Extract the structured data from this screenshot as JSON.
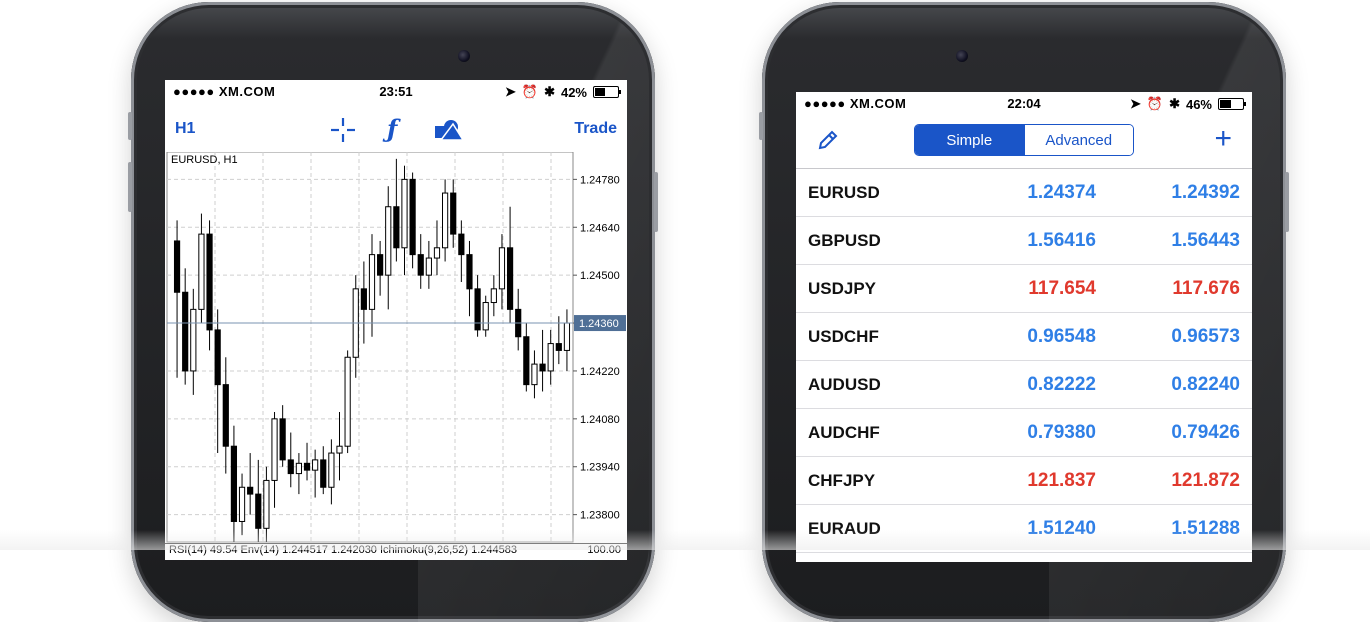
{
  "left_phone": {
    "status": {
      "carrier": "●●●●● XM.COM",
      "time": "23:51",
      "battery_pct": "42%",
      "battery_level": 0.42
    },
    "toolbar": {
      "timeframe": "H1",
      "trade_label": "Trade",
      "icons": [
        "crosshair-icon",
        "function-icon",
        "shapes-icon"
      ]
    },
    "chart": {
      "title": "EURUSD, H1",
      "price_labels": [
        "1.24780",
        "1.24640",
        "1.24500",
        "1.24360",
        "1.24220",
        "1.24080",
        "1.23940",
        "1.23800"
      ],
      "current_price": "1.24360",
      "indicators": "RSI(14) 49.54 Env(14) 1.244517 1.242030 Ichimoku(9,26,52) 1.244583",
      "indicator_right": "100.00"
    }
  },
  "chart_data": {
    "type": "candlestick",
    "title": "EURUSD, H1",
    "ylim": [
      1.2372,
      1.2486
    ],
    "y_ticks": [
      1.2478,
      1.2464,
      1.245,
      1.2436,
      1.2422,
      1.2408,
      1.2394,
      1.238
    ],
    "current": 1.2436,
    "candles": [
      {
        "o": 1.246,
        "h": 1.2466,
        "l": 1.242,
        "c": 1.2445
      },
      {
        "o": 1.2445,
        "h": 1.2452,
        "l": 1.2418,
        "c": 1.2422
      },
      {
        "o": 1.2422,
        "h": 1.2446,
        "l": 1.2415,
        "c": 1.244
      },
      {
        "o": 1.244,
        "h": 1.2468,
        "l": 1.2436,
        "c": 1.2462
      },
      {
        "o": 1.2462,
        "h": 1.2466,
        "l": 1.2428,
        "c": 1.2434
      },
      {
        "o": 1.2434,
        "h": 1.244,
        "l": 1.2398,
        "c": 1.2418
      },
      {
        "o": 1.2418,
        "h": 1.2426,
        "l": 1.2392,
        "c": 1.24
      },
      {
        "o": 1.24,
        "h": 1.2406,
        "l": 1.2372,
        "c": 1.2378
      },
      {
        "o": 1.2378,
        "h": 1.2392,
        "l": 1.2374,
        "c": 1.2388
      },
      {
        "o": 1.2388,
        "h": 1.2398,
        "l": 1.238,
        "c": 1.2386
      },
      {
        "o": 1.2386,
        "h": 1.2396,
        "l": 1.2372,
        "c": 1.2376
      },
      {
        "o": 1.2376,
        "h": 1.2394,
        "l": 1.2372,
        "c": 1.239
      },
      {
        "o": 1.239,
        "h": 1.241,
        "l": 1.2382,
        "c": 1.2408
      },
      {
        "o": 1.2408,
        "h": 1.2412,
        "l": 1.2394,
        "c": 1.2396
      },
      {
        "o": 1.2396,
        "h": 1.2404,
        "l": 1.2388,
        "c": 1.2392
      },
      {
        "o": 1.2392,
        "h": 1.2398,
        "l": 1.2386,
        "c": 1.2395
      },
      {
        "o": 1.2395,
        "h": 1.2401,
        "l": 1.239,
        "c": 1.2393
      },
      {
        "o": 1.2393,
        "h": 1.2399,
        "l": 1.2385,
        "c": 1.2396
      },
      {
        "o": 1.2396,
        "h": 1.24,
        "l": 1.2386,
        "c": 1.2388
      },
      {
        "o": 1.2388,
        "h": 1.2402,
        "l": 1.2383,
        "c": 1.2398
      },
      {
        "o": 1.2398,
        "h": 1.241,
        "l": 1.239,
        "c": 1.24
      },
      {
        "o": 1.24,
        "h": 1.2428,
        "l": 1.2398,
        "c": 1.2426
      },
      {
        "o": 1.2426,
        "h": 1.245,
        "l": 1.242,
        "c": 1.2446
      },
      {
        "o": 1.2446,
        "h": 1.2454,
        "l": 1.243,
        "c": 1.244
      },
      {
        "o": 1.244,
        "h": 1.2462,
        "l": 1.2432,
        "c": 1.2456
      },
      {
        "o": 1.2456,
        "h": 1.246,
        "l": 1.2444,
        "c": 1.245
      },
      {
        "o": 1.245,
        "h": 1.2476,
        "l": 1.244,
        "c": 1.247
      },
      {
        "o": 1.247,
        "h": 1.2484,
        "l": 1.2454,
        "c": 1.2458
      },
      {
        "o": 1.2458,
        "h": 1.2482,
        "l": 1.245,
        "c": 1.2478
      },
      {
        "o": 1.2478,
        "h": 1.248,
        "l": 1.2452,
        "c": 1.2456
      },
      {
        "o": 1.2456,
        "h": 1.2462,
        "l": 1.2446,
        "c": 1.245
      },
      {
        "o": 1.245,
        "h": 1.246,
        "l": 1.2446,
        "c": 1.2455
      },
      {
        "o": 1.2455,
        "h": 1.2466,
        "l": 1.245,
        "c": 1.2458
      },
      {
        "o": 1.2458,
        "h": 1.2478,
        "l": 1.2454,
        "c": 1.2474
      },
      {
        "o": 1.2474,
        "h": 1.2478,
        "l": 1.2458,
        "c": 1.2462
      },
      {
        "o": 1.2462,
        "h": 1.2466,
        "l": 1.2448,
        "c": 1.2456
      },
      {
        "o": 1.2456,
        "h": 1.246,
        "l": 1.2438,
        "c": 1.2446
      },
      {
        "o": 1.2446,
        "h": 1.245,
        "l": 1.2432,
        "c": 1.2434
      },
      {
        "o": 1.2434,
        "h": 1.2444,
        "l": 1.2432,
        "c": 1.2442
      },
      {
        "o": 1.2442,
        "h": 1.245,
        "l": 1.2438,
        "c": 1.2446
      },
      {
        "o": 1.2446,
        "h": 1.2462,
        "l": 1.244,
        "c": 1.2458
      },
      {
        "o": 1.2458,
        "h": 1.247,
        "l": 1.2436,
        "c": 1.244
      },
      {
        "o": 1.244,
        "h": 1.2446,
        "l": 1.2428,
        "c": 1.2432
      },
      {
        "o": 1.2432,
        "h": 1.2436,
        "l": 1.2416,
        "c": 1.2418
      },
      {
        "o": 1.2418,
        "h": 1.2428,
        "l": 1.2414,
        "c": 1.2424
      },
      {
        "o": 1.2424,
        "h": 1.2434,
        "l": 1.2416,
        "c": 1.2422
      },
      {
        "o": 1.2422,
        "h": 1.2434,
        "l": 1.2418,
        "c": 1.243
      },
      {
        "o": 1.243,
        "h": 1.2438,
        "l": 1.2424,
        "c": 1.2428
      },
      {
        "o": 1.2428,
        "h": 1.244,
        "l": 1.2422,
        "c": 1.2436
      }
    ]
  },
  "right_phone": {
    "status": {
      "carrier": "●●●●● XM.COM",
      "time": "22:04",
      "battery_pct": "46%",
      "battery_level": 0.46
    },
    "toolbar": {
      "seg_simple": "Simple",
      "seg_advanced": "Advanced",
      "plus": "+"
    },
    "quotes": [
      {
        "symbol": "EURUSD",
        "bid": "1.24374",
        "ask": "1.24392",
        "color": "blue"
      },
      {
        "symbol": "GBPUSD",
        "bid": "1.56416",
        "ask": "1.56443",
        "color": "blue"
      },
      {
        "symbol": "USDJPY",
        "bid": "117.654",
        "ask": "117.676",
        "color": "red"
      },
      {
        "symbol": "USDCHF",
        "bid": "0.96548",
        "ask": "0.96573",
        "color": "blue"
      },
      {
        "symbol": "AUDUSD",
        "bid": "0.82222",
        "ask": "0.82240",
        "color": "blue"
      },
      {
        "symbol": "AUDCHF",
        "bid": "0.79380",
        "ask": "0.79426",
        "color": "blue"
      },
      {
        "symbol": "CHFJPY",
        "bid": "121.837",
        "ask": "121.872",
        "color": "red"
      },
      {
        "symbol": "EURAUD",
        "bid": "1.51240",
        "ask": "1.51288",
        "color": "blue"
      }
    ]
  }
}
